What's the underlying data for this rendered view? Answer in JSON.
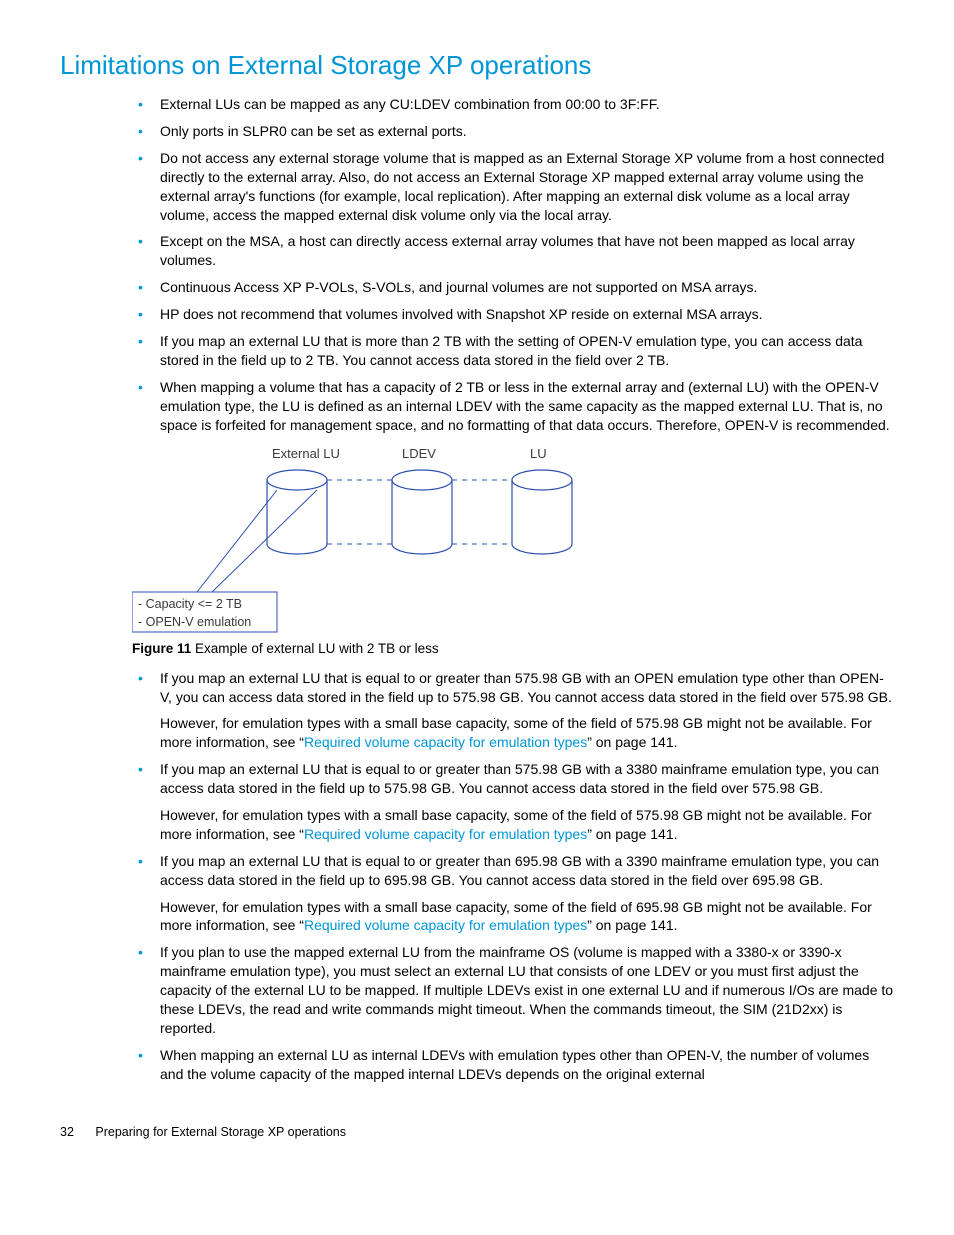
{
  "heading": "Limitations on External Storage XP operations",
  "bullets_top": [
    "External LUs can be mapped as any CU:LDEV combination from 00:00 to 3F:FF.",
    "Only ports in SLPR0 can be set as external ports.",
    "Do not access any external storage volume that is mapped as an External Storage XP volume from a host connected directly to the external array. Also, do not access an External Storage XP mapped external array volume using the external array's functions (for example, local replication). After mapping an external disk volume as a local array volume, access the mapped external disk volume only via the local array.",
    "Except on the MSA, a host can directly access external array volumes that have not been mapped as local array volumes.",
    "Continuous Access XP P-VOLs, S-VOLs, and journal volumes are not supported on MSA arrays.",
    "HP does not recommend that volumes involved with Snapshot XP reside on external MSA arrays.",
    "If you map an external LU that is more than 2 TB with the setting of OPEN-V emulation type, you can access data stored in the field up to 2 TB. You cannot access data stored in the field over 2 TB.",
    "When mapping a volume that has a capacity of 2 TB or less in the external array and (external LU) with the OPEN-V emulation type, the LU is defined as an internal LDEV with the same capacity as the mapped external LU. That is, no space is forfeited for management space, and no formatting of that data occurs. Therefore, OPEN-V is recommended."
  ],
  "figure": {
    "label_ext": "External LU",
    "label_ldev": "LDEV",
    "label_lu": "LU",
    "box_line1": "- Capacity <= 2 TB",
    "box_line2": "- OPEN-V emulation",
    "caption_label": "Figure 11",
    "caption_text": "Example of external LU with 2 TB or less"
  },
  "bullets_bottom": [
    {
      "main": "If you map an external LU that is equal to or greater than 575.98 GB with an OPEN emulation type other than OPEN-V, you can access data stored in the field up to 575.98 GB. You cannot access data stored in the field over 575.98 GB.",
      "sub_pre": "However, for emulation types with a small base capacity, some of the field of 575.98 GB might not be available. For more information, see “",
      "sub_link": "Required volume capacity for emulation types",
      "sub_post": "” on page 141."
    },
    {
      "main": "If you map an external LU that is equal to or greater than 575.98 GB with a 3380 mainframe emulation type, you can access data stored in the field up to 575.98 GB. You cannot access data stored in the field over 575.98 GB.",
      "sub_pre": "However, for emulation types with a small base capacity, some of the field of 575.98 GB might not be available. For more information, see “",
      "sub_link": "Required volume capacity for emulation types",
      "sub_post": "” on page 141."
    },
    {
      "main": "If you map an external LU that is equal to or greater than 695.98 GB with a 3390 mainframe emulation type, you can access data stored in the field up to 695.98 GB. You cannot access data stored in the field over 695.98 GB.",
      "sub_pre": "However, for emulation types with a small base capacity, some of the field of 695.98 GB might not be available. For more information, see “",
      "sub_link": "Required volume capacity for emulation types",
      "sub_post": "” on page 141."
    },
    {
      "main": "If you plan to use the mapped external LU from the mainframe OS (volume is mapped with a 3380-x or 3390-x mainframe emulation type), you must select an external LU that consists of one LDEV or you must first adjust the capacity of the external LU to be mapped. If multiple LDEVs exist in one external LU and if numerous I/Os are made to these LDEVs, the read and write commands might timeout. When the commands timeout, the SIM (21D2xx) is reported."
    },
    {
      "main": "When mapping an external LU as internal LDEVs with emulation types other than OPEN-V, the number of volumes and the volume capacity of the mapped internal LDEVs depends on the original external"
    }
  ],
  "footer": {
    "page": "32",
    "title": "Preparing for External Storage XP operations"
  }
}
